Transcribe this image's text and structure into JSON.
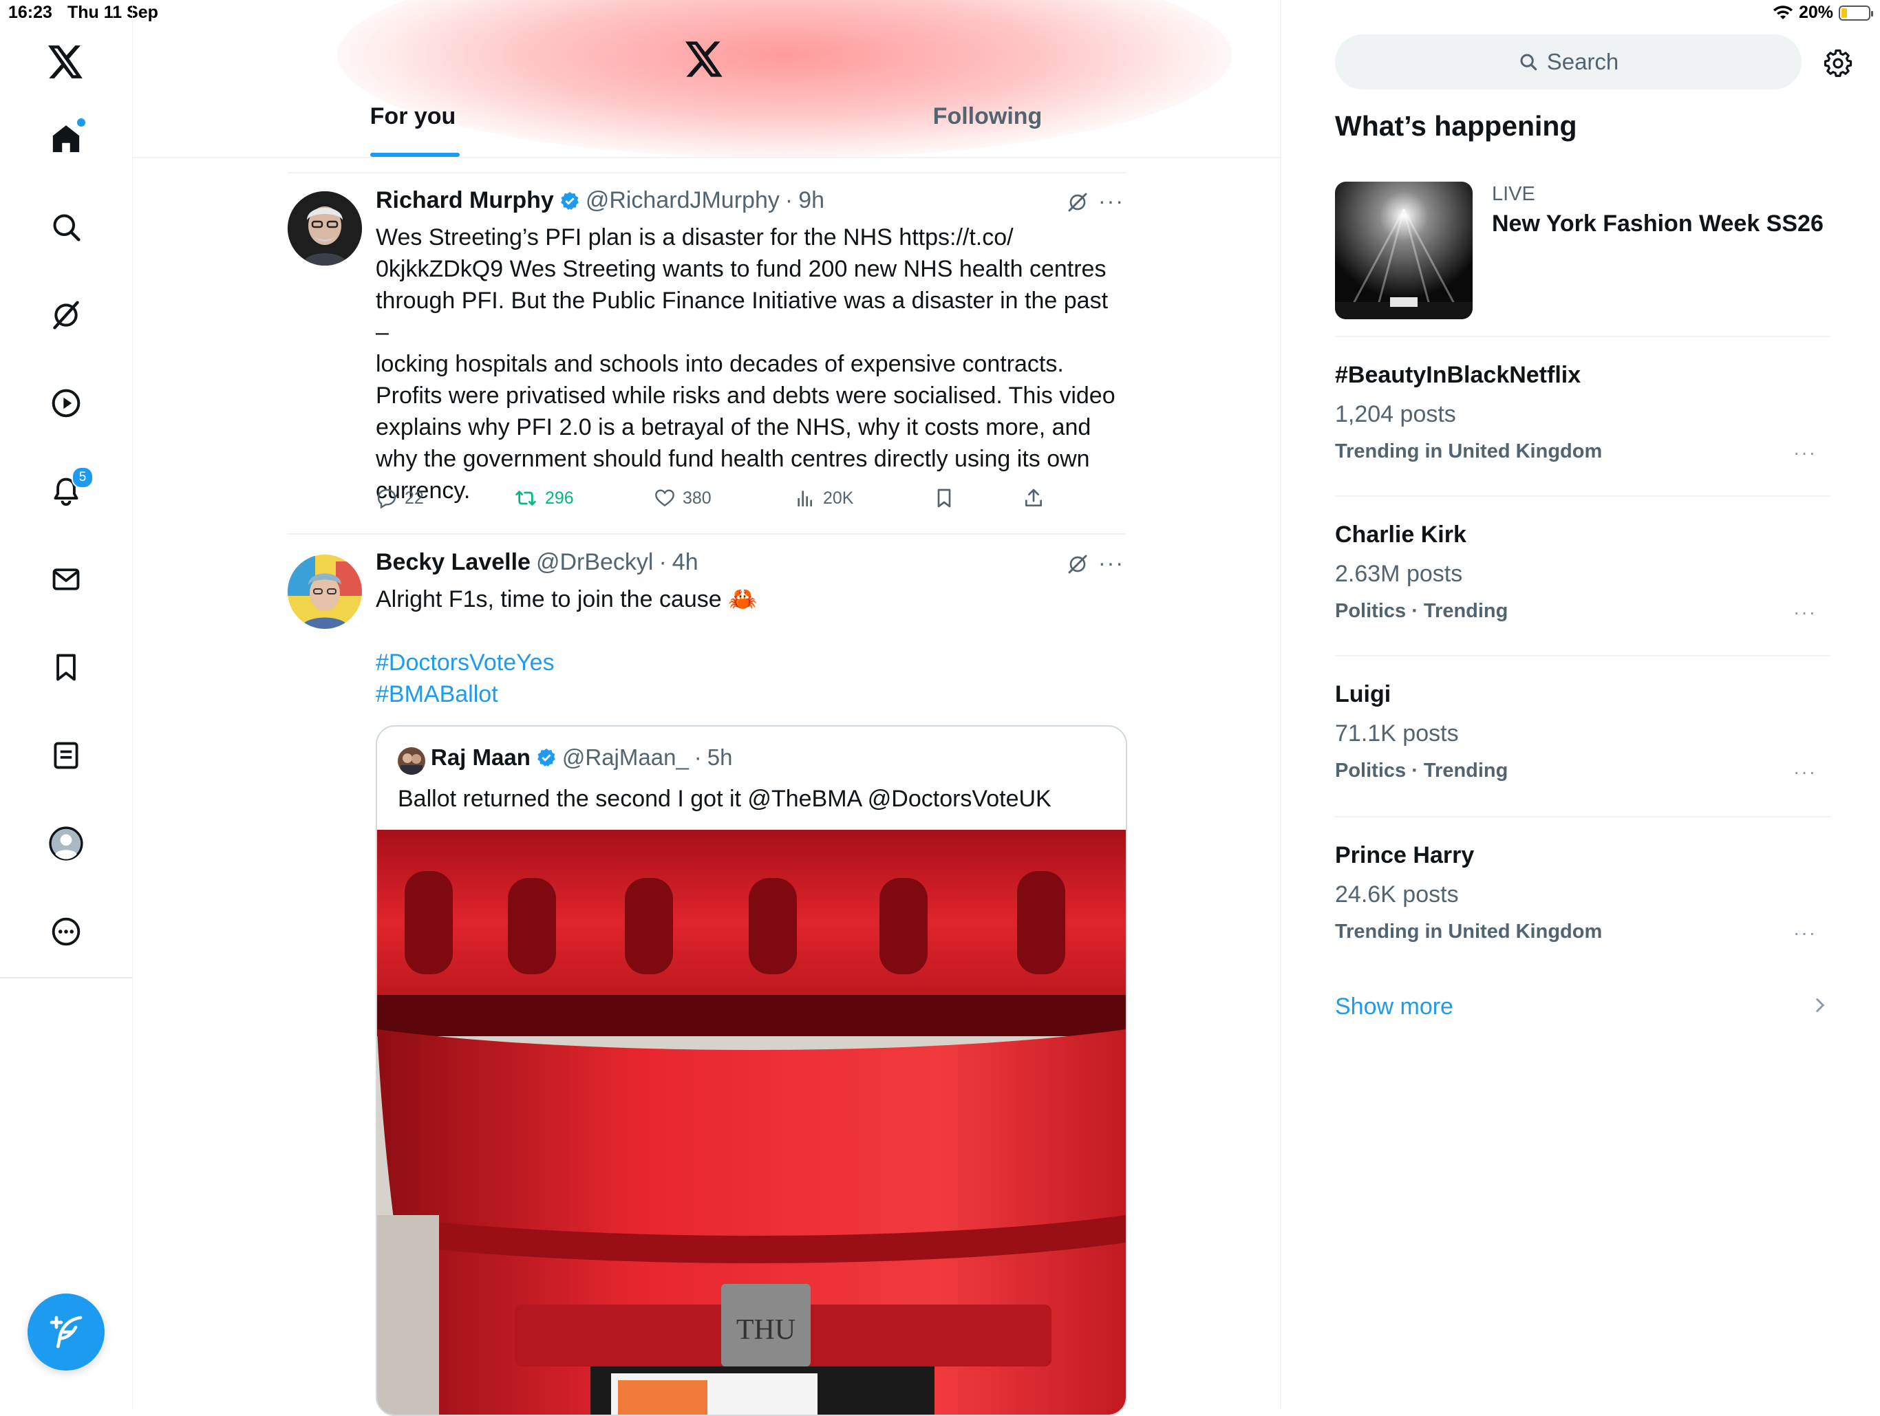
{
  "status_bar": {
    "time": "16:23",
    "date": "Thu 11 Sep",
    "battery": "20%",
    "battery_level": 0.2
  },
  "nav": {
    "items": [
      "home",
      "explore",
      "grok",
      "media",
      "notifications",
      "messages",
      "bookmarks",
      "lists",
      "profile",
      "more"
    ],
    "notifications_badge": "5"
  },
  "header": {
    "tab_for_you": "For you",
    "tab_following": "Following"
  },
  "tweets": [
    {
      "name": "Richard Murphy",
      "handle": "@RichardJMurphy",
      "time": "9h",
      "lines": [
        "Wes Streeting’s PFI plan is a disaster for the NHS https://t.co/",
        "0kjkkZDkQ9 Wes Streeting wants to fund 200 new NHS health centres",
        "through PFI. But the Public Finance Initiative was a disaster in the past –",
        "locking hospitals and schools into decades of expensive contracts.",
        "Profits were privatised while risks and debts were socialised. This video",
        "explains why PFI 2.0 is a betrayal of the NHS, why it costs more, and",
        "why the government should fund health centres directly using its own",
        "currency."
      ],
      "replies": "22",
      "reposts": "296",
      "likes": "380",
      "views": "20K"
    },
    {
      "name": "Becky Lavelle",
      "handle": "@DrBeckyl",
      "time": "4h",
      "text": "Alright F1s, time to join the cause 🦀",
      "hashtags": [
        "#DoctorsVoteYes",
        "#BMABallot"
      ],
      "quote": {
        "name": "Raj Maan",
        "handle": "@RajMaan_",
        "time": "5h",
        "text": "Ballot returned the second I got it @TheBMA @DoctorsVoteUK",
        "image_text": "THU"
      }
    }
  ],
  "sidebar": {
    "search_placeholder": "Search",
    "section_title": "What’s happening",
    "live": {
      "label": "LIVE",
      "title": "New York Fashion Week SS26"
    },
    "trends": [
      {
        "title": "#BeautyInBlackNetflix",
        "count": "1,204 posts",
        "context": "Trending in United Kingdom"
      },
      {
        "title": "Charlie Kirk",
        "count": "2.63M posts",
        "context": "Politics · Trending"
      },
      {
        "title": "Luigi",
        "count": "71.1K posts",
        "context": "Politics · Trending"
      },
      {
        "title": "Prince Harry",
        "count": "24.6K posts",
        "context": "Trending in United Kingdom"
      }
    ],
    "show_more": "Show more"
  },
  "colors": {
    "accent": "#1d9bf0",
    "repost_green": "#00ba7c",
    "muted": "#536471"
  }
}
